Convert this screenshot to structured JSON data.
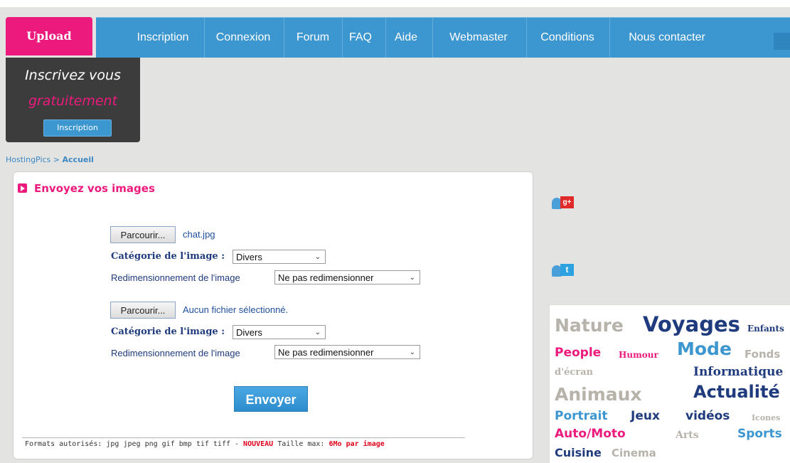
{
  "nav": {
    "upload": "Upload",
    "items": [
      "Inscription",
      "Connexion",
      "Forum",
      "FAQ",
      "Aide",
      "Webmaster",
      "Conditions",
      "Nous contacter"
    ]
  },
  "promo": {
    "line1": "Inscrivez vous",
    "line2": "gratuitement",
    "button": "Inscription"
  },
  "breadcrumb": {
    "site": "HostingPics",
    "separator": " > ",
    "current": "Accueil"
  },
  "upload_form": {
    "title": "Envoyez vos images",
    "files": [
      {
        "browse_label": "Parcourir...",
        "file_name": "chat.jpg",
        "category_label": "Catégorie de l'image :",
        "category_value": "Divers",
        "resize_label": "Redimensionnement de l'image",
        "resize_value": "Ne pas redimensionner"
      },
      {
        "browse_label": "Parcourir...",
        "file_name": "Aucun fichier sélectionné.",
        "category_label": "Catégorie de l'image :",
        "category_value": "Divers",
        "resize_label": "Redimensionnement de l'image",
        "resize_value": "Ne pas redimensionner"
      }
    ],
    "submit": "Envoyer",
    "formats_text": "Formats autorisés: jpg jpeg png gif bmp tif tiff - ",
    "new_label": "NOUVEAU",
    "size_text": " Taille max: ",
    "size_value": "6Mo par image"
  },
  "social": {
    "gplus_text": "g+",
    "twitter_text": "t"
  },
  "tags": [
    "Nature",
    "Voyages",
    "Enfants",
    "People",
    "Humour",
    "Mode",
    "Fonds",
    "d'écran",
    "Informatique",
    "Animaux",
    "Actualité",
    "Portrait",
    "Jeux",
    "vidéos",
    "Icones",
    "Auto/Moto",
    "Arts",
    "Sports",
    "Cuisine",
    "Cinema"
  ],
  "colors": {
    "pink": "#ec1a7d",
    "nav_blue": "#3c96cf",
    "dark_blue": "#1f3b7d",
    "grey_tag": "#b7b2aa",
    "background": "#e3e3e1"
  }
}
